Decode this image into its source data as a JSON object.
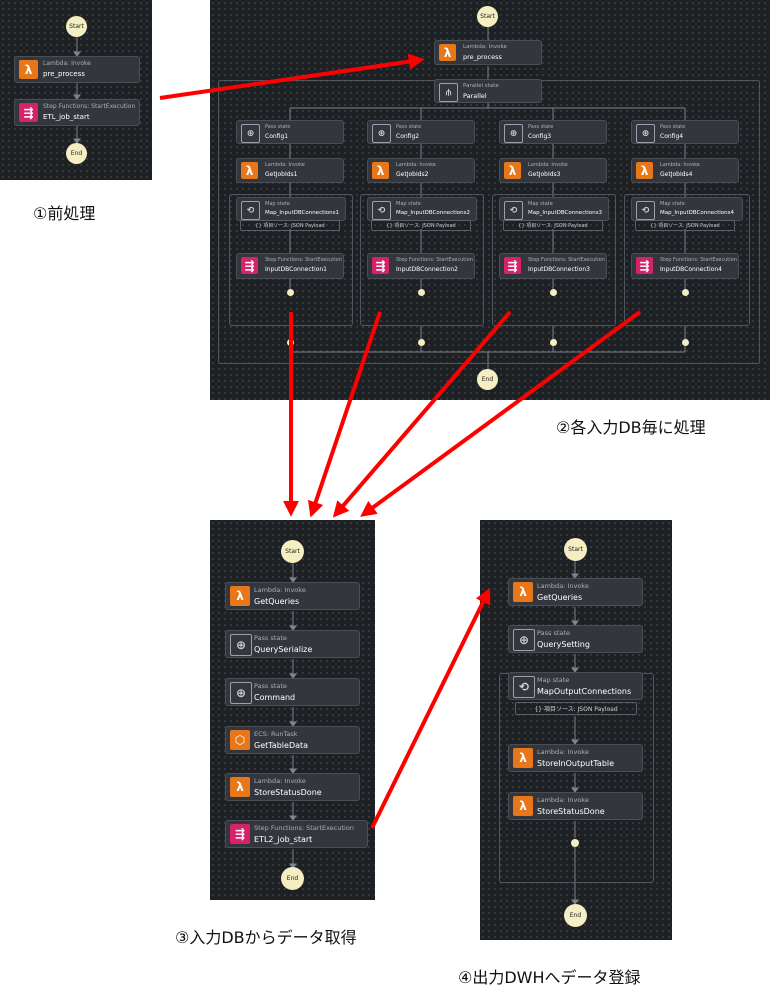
{
  "terminal": {
    "start": "Start",
    "end": "End"
  },
  "panel1": {
    "n1": {
      "type": "Lambda: Invoke",
      "name": "pre_process"
    },
    "n2": {
      "type": "Step Functions: StartExecution",
      "name": "ETL_job_start"
    }
  },
  "panel2": {
    "pre": {
      "type": "Lambda: Invoke",
      "name": "pre_process"
    },
    "parallel": {
      "type": "Parallel state",
      "name": "Parallel"
    },
    "branches": [
      {
        "pass_type": "Pass state",
        "pass": "Config1",
        "lam_type": "Lambda: Invoke",
        "lam": "GetJobIds1",
        "map_type": "Map state",
        "map": "Map_InputDBConnections1",
        "src": "{} 項目ソース: JSON Payload",
        "sfn_type": "Step Functions: StartExecution",
        "sfn": "InputDBConnection1"
      },
      {
        "pass_type": "Pass state",
        "pass": "Config2",
        "lam_type": "Lambda: Invoke",
        "lam": "GetJobIds2",
        "map_type": "Map state",
        "map": "Map_InputDBConnections2",
        "src": "{} 項目ソース: JSON Payload",
        "sfn_type": "Step Functions: StartExecution",
        "sfn": "InputDBConnection2"
      },
      {
        "pass_type": "Pass state",
        "pass": "Config3",
        "lam_type": "Lambda: Invoke",
        "lam": "GetJobIds3",
        "map_type": "Map state",
        "map": "Map_InputDBConnections3",
        "src": "{} 項目ソース: JSON Payload",
        "sfn_type": "Step Functions: StartExecution",
        "sfn": "InputDBConnection3"
      },
      {
        "pass_type": "Pass state",
        "pass": "Config4",
        "lam_type": "Lambda: Invoke",
        "lam": "GetJobIds4",
        "map_type": "Map state",
        "map": "Map_InputDBConnections4",
        "src": "{} 項目ソース: JSON Payload",
        "sfn_type": "Step Functions: StartExecution",
        "sfn": "InputDBConnection4"
      }
    ]
  },
  "panel3": {
    "n1": {
      "type": "Lambda: Invoke",
      "name": "GetQueries"
    },
    "n2": {
      "type": "Pass state",
      "name": "QuerySerialize"
    },
    "n3": {
      "type": "Pass state",
      "name": "Command"
    },
    "n4": {
      "type": "ECS: RunTask",
      "name": "GetTableData"
    },
    "n5": {
      "type": "Lambda: Invoke",
      "name": "StoreStatusDone"
    },
    "n6": {
      "type": "Step Functions: StartExecution",
      "name": "ETL2_job_start"
    }
  },
  "panel4": {
    "n1": {
      "type": "Lambda: Invoke",
      "name": "GetQueries"
    },
    "n2": {
      "type": "Pass state",
      "name": "QuerySetting"
    },
    "n3": {
      "type": "Map state",
      "name": "MapOutputConnections"
    },
    "src": "{} 項目ソース: JSON Payload",
    "n4": {
      "type": "Lambda: Invoke",
      "name": "StoreInOutputTable"
    },
    "n5": {
      "type": "Lambda: Invoke",
      "name": "StoreStatusDone"
    }
  },
  "captions": {
    "c1": "①前処理",
    "c2": "②各入力DB毎に処理",
    "c3": "③入力DBからデータ取得",
    "c4": "④出力DWHへデータ登録"
  },
  "colors": {
    "panel": "#1e2124",
    "node": "#33373d",
    "lambda": "#e8771a",
    "stepfunctions": "#d6226b",
    "terminal": "#f4eec2",
    "arrow": "#ff0000"
  },
  "icons": {
    "lambda": "lambda-icon",
    "sfn": "step-functions-icon",
    "pass": "pass-icon",
    "map": "map-icon",
    "parallel": "parallel-icon",
    "ecs": "ecs-icon"
  }
}
